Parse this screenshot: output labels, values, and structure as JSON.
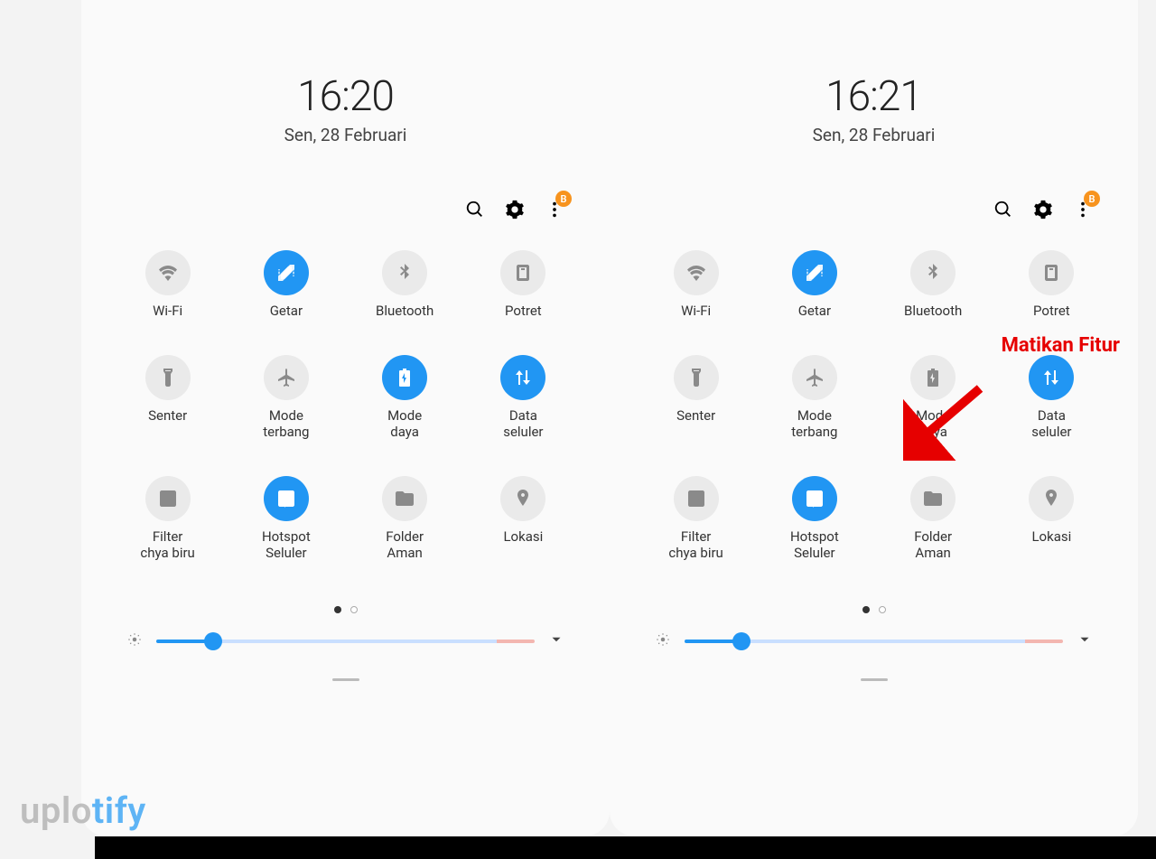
{
  "panels": [
    {
      "time": "16:20",
      "date": "Sen, 28 Februari",
      "badge": "B",
      "tiles": [
        {
          "label": "Wi-Fi",
          "active": false,
          "icon": "wifi"
        },
        {
          "label": "Getar",
          "active": true,
          "icon": "vibrate"
        },
        {
          "label": "Bluetooth",
          "active": false,
          "icon": "bluetooth"
        },
        {
          "label": "Potret",
          "active": false,
          "icon": "portrait"
        },
        {
          "label": "Senter",
          "active": false,
          "icon": "flashlight"
        },
        {
          "label": "Mode\nterbang",
          "active": false,
          "icon": "airplane"
        },
        {
          "label": "Mode\ndaya",
          "active": true,
          "icon": "battery"
        },
        {
          "label": "Data\nseluler",
          "active": true,
          "icon": "data"
        },
        {
          "label": "Filter\nchya biru",
          "active": false,
          "icon": "bluefilter"
        },
        {
          "label": "Hotspot\nSeluler",
          "active": true,
          "icon": "hotspot"
        },
        {
          "label": "Folder\nAman",
          "active": false,
          "icon": "folder"
        },
        {
          "label": "Lokasi",
          "active": false,
          "icon": "location"
        }
      ],
      "brightness_percent": 15
    },
    {
      "time": "16:21",
      "date": "Sen, 28 Februari",
      "badge": "B",
      "tiles": [
        {
          "label": "Wi-Fi",
          "active": false,
          "icon": "wifi"
        },
        {
          "label": "Getar",
          "active": true,
          "icon": "vibrate"
        },
        {
          "label": "Bluetooth",
          "active": false,
          "icon": "bluetooth"
        },
        {
          "label": "Potret",
          "active": false,
          "icon": "portrait"
        },
        {
          "label": "Senter",
          "active": false,
          "icon": "flashlight"
        },
        {
          "label": "Mode\nterbang",
          "active": false,
          "icon": "airplane"
        },
        {
          "label": "Mode\ndaya",
          "active": false,
          "icon": "battery"
        },
        {
          "label": "Data\nseluler",
          "active": true,
          "icon": "data"
        },
        {
          "label": "Filter\nchya biru",
          "active": false,
          "icon": "bluefilter"
        },
        {
          "label": "Hotspot\nSeluler",
          "active": true,
          "icon": "hotspot"
        },
        {
          "label": "Folder\nAman",
          "active": false,
          "icon": "folder"
        },
        {
          "label": "Lokasi",
          "active": false,
          "icon": "location"
        }
      ],
      "brightness_percent": 15
    }
  ],
  "annotation": {
    "text": "Matikan\nFitur"
  },
  "watermark": {
    "gray": "uplo",
    "blue": "tify"
  },
  "colors": {
    "accent": "#2196f3",
    "tile_off": "#eaeaea",
    "annot": "#e60000",
    "badge": "#f7931e"
  }
}
